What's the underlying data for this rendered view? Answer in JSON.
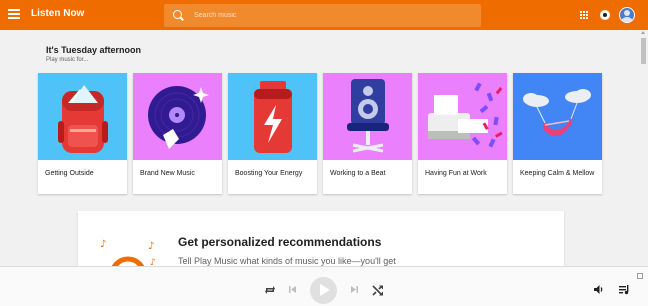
{
  "header": {
    "title": "Listen Now",
    "search_placeholder": "Search music"
  },
  "section": {
    "title": "It's Tuesday afternoon",
    "subtitle": "Play music for..."
  },
  "cards": [
    {
      "label": "Getting Outside",
      "color": "#4fc3f7",
      "icon": "backpack-icon"
    },
    {
      "label": "Brand New Music",
      "color": "#ea80fc",
      "icon": "vinyl-record-icon"
    },
    {
      "label": "Boosting Your Energy",
      "color": "#4fc3f7",
      "icon": "battery-icon"
    },
    {
      "label": "Working to a Beat",
      "color": "#ea80fc",
      "icon": "speaker-chair-icon"
    },
    {
      "label": "Having Fun at Work",
      "color": "#ea80fc",
      "icon": "printer-icon"
    },
    {
      "label": "Keeping Calm & Mellow",
      "color": "#4285f4",
      "icon": "hammock-icon"
    }
  ],
  "recommendation": {
    "title": "Get personalized recommendations",
    "body": "Tell Play Music what kinds of music you like—you'll get"
  },
  "colors": {
    "accent": "#ef6c00",
    "search_bg": "#f18a2c"
  },
  "player": {
    "controls": [
      "repeat-icon",
      "previous-icon",
      "play-icon",
      "next-icon",
      "shuffle-icon",
      "volume-icon",
      "queue-icon"
    ]
  }
}
